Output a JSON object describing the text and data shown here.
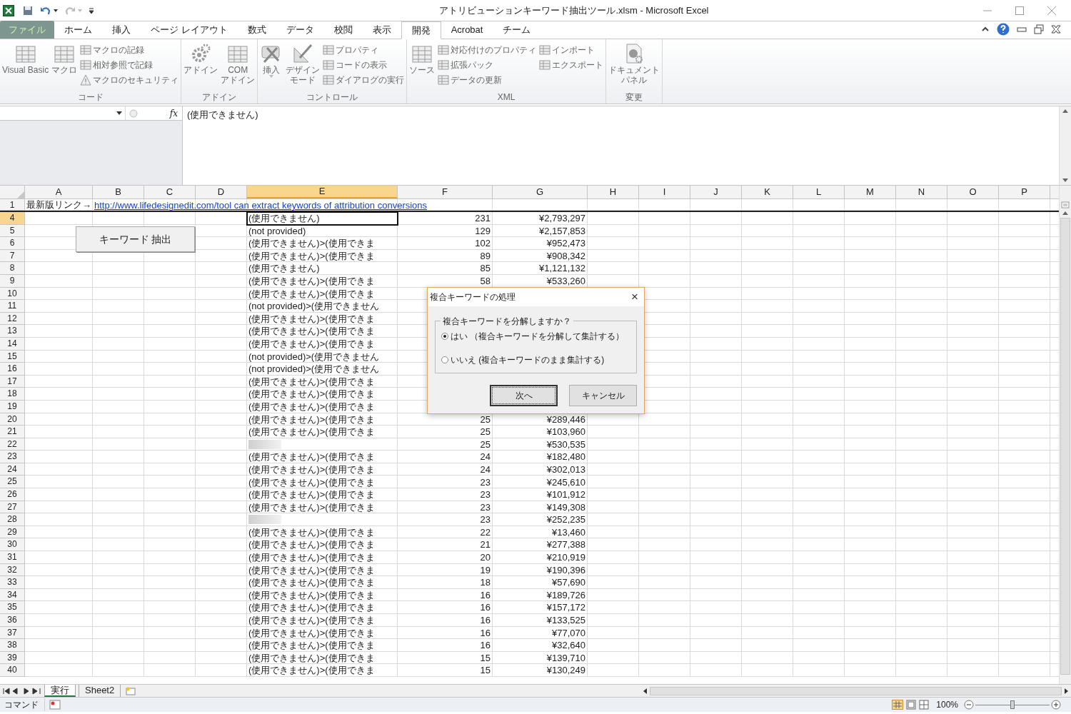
{
  "window": {
    "title": "アトリビューションキーワード抽出ツール.xlsm - Microsoft Excel"
  },
  "ribbon_tabs": [
    {
      "label": "ファイル",
      "kind": "file",
      "selected": false
    },
    {
      "label": "ホーム",
      "kind": "tab",
      "selected": false
    },
    {
      "label": "挿入",
      "kind": "tab",
      "selected": false
    },
    {
      "label": "ページ レイアウト",
      "kind": "tab",
      "selected": false
    },
    {
      "label": "数式",
      "kind": "tab",
      "selected": false
    },
    {
      "label": "データ",
      "kind": "tab",
      "selected": false
    },
    {
      "label": "校閲",
      "kind": "tab",
      "selected": false
    },
    {
      "label": "表示",
      "kind": "tab",
      "selected": false
    },
    {
      "label": "開発",
      "kind": "tab",
      "selected": true
    },
    {
      "label": "Acrobat",
      "kind": "tab",
      "selected": false
    },
    {
      "label": "チーム",
      "kind": "tab",
      "selected": false
    }
  ],
  "ribbon_groups": [
    {
      "label": "コード",
      "large": [
        [
          "Visual Basic"
        ],
        [
          "マクロ"
        ]
      ],
      "small": [
        [
          "マクロの記録",
          "相対参照で記録",
          "マクロのセキュリティ"
        ]
      ]
    },
    {
      "label": "アドイン",
      "large": [
        [
          "アドイン"
        ],
        [
          "COM",
          "アドイン"
        ]
      ]
    },
    {
      "label": "コントロール",
      "large": [
        [
          "挿入"
        ],
        [
          "デザイン",
          "モード"
        ]
      ],
      "small": [
        [
          "プロパティ",
          "コードの表示",
          "ダイアログの実行"
        ]
      ]
    },
    {
      "label": "XML",
      "large": [
        [
          "ソース"
        ]
      ],
      "small": [
        [
          "対応付けのプロパティ",
          "拡張パック",
          "データの更新"
        ],
        [
          "インポート",
          "エクスポート"
        ]
      ]
    },
    {
      "label": "変更",
      "large": [
        [
          "ドキュメント",
          "パネル"
        ]
      ]
    }
  ],
  "formula_bar": {
    "fx": "fx",
    "value": "(使用できません)"
  },
  "columns": [
    {
      "label": "A",
      "selected": false
    },
    {
      "label": "B",
      "selected": false
    },
    {
      "label": "C",
      "selected": false
    },
    {
      "label": "D",
      "selected": false
    },
    {
      "label": "E",
      "selected": true
    },
    {
      "label": "F",
      "selected": false
    },
    {
      "label": "G",
      "selected": false
    },
    {
      "label": "H",
      "selected": false
    },
    {
      "label": "I",
      "selected": false
    },
    {
      "label": "J",
      "selected": false
    },
    {
      "label": "K",
      "selected": false
    },
    {
      "label": "L",
      "selected": false
    },
    {
      "label": "M",
      "selected": false
    },
    {
      "label": "N",
      "selected": false
    },
    {
      "label": "O",
      "selected": false
    },
    {
      "label": "P",
      "selected": false
    }
  ],
  "rows": [
    {
      "number": "1",
      "selected": false,
      "a": "最新版リンク→",
      "link": "http://www.lifedesignedit.com/tool can extract keywords of attribution conversions"
    },
    {
      "number": "4",
      "selected": true,
      "e": "(使用できません)",
      "f": "231",
      "g": "¥2,793,297"
    },
    {
      "number": "5",
      "selected": false,
      "e": "(not provided)",
      "f": "129",
      "g": "¥2,157,853"
    },
    {
      "number": "6",
      "selected": false,
      "e": "(使用できません)>(使用できま",
      "f": "102",
      "g": "¥952,473"
    },
    {
      "number": "7",
      "selected": false,
      "e": "(使用できません)>(使用できま",
      "f": "89",
      "g": "¥908,342"
    },
    {
      "number": "8",
      "selected": false,
      "e": "(使用できません)",
      "f": "85",
      "g": "¥1,121,132"
    },
    {
      "number": "9",
      "selected": false,
      "e": "(使用できません)>(使用できま",
      "f": "58",
      "g": "¥533,260"
    },
    {
      "number": "10",
      "selected": false,
      "e": "(使用できません)>(使用できま"
    },
    {
      "number": "11",
      "selected": false,
      "e": "(not provided)>(使用できません"
    },
    {
      "number": "12",
      "selected": false,
      "e": "(使用できません)>(使用できま"
    },
    {
      "number": "13",
      "selected": false,
      "e": "(使用できません)>(使用できま"
    },
    {
      "number": "14",
      "selected": false,
      "e": "(使用できません)>(使用できま"
    },
    {
      "number": "15",
      "selected": false,
      "e": "(not provided)>(使用できません"
    },
    {
      "number": "16",
      "selected": false,
      "e": "(not provided)>(使用できません"
    },
    {
      "number": "17",
      "selected": false,
      "e": "(使用できません)>(使用できま"
    },
    {
      "number": "18",
      "selected": false,
      "e": "(使用できません)>(使用できま"
    },
    {
      "number": "19",
      "selected": false,
      "e": "(使用できません)>(使用できま"
    },
    {
      "number": "20",
      "selected": false,
      "e": "(使用できません)>(使用できま",
      "f": "25",
      "g": "¥289,446"
    },
    {
      "number": "21",
      "selected": false,
      "e": "(使用できません)>(使用できま",
      "f": "25",
      "g": "¥103,960"
    },
    {
      "number": "22",
      "selected": false,
      "redacted": true,
      "f": "25",
      "g": "¥530,535"
    },
    {
      "number": "23",
      "selected": false,
      "e": "(使用できません)>(使用できま",
      "f": "24",
      "g": "¥182,480"
    },
    {
      "number": "24",
      "selected": false,
      "e": "(使用できません)>(使用できま",
      "f": "24",
      "g": "¥302,013"
    },
    {
      "number": "25",
      "selected": false,
      "e": "(使用できません)>(使用できま",
      "f": "23",
      "g": "¥245,610"
    },
    {
      "number": "26",
      "selected": false,
      "e": "(使用できません)>(使用できま",
      "f": "23",
      "g": "¥101,912"
    },
    {
      "number": "27",
      "selected": false,
      "e": "(使用できません)>(使用できま",
      "f": "23",
      "g": "¥149,308"
    },
    {
      "number": "28",
      "selected": false,
      "redacted": true,
      "f": "23",
      "g": "¥252,235"
    },
    {
      "number": "29",
      "selected": false,
      "e": "(使用できません)>(使用できま",
      "f": "22",
      "g": "¥13,460"
    },
    {
      "number": "30",
      "selected": false,
      "e": "(使用できません)>(使用できま",
      "f": "21",
      "g": "¥277,388"
    },
    {
      "number": "31",
      "selected": false,
      "e": "(使用できません)>(使用できま",
      "f": "20",
      "g": "¥210,919"
    },
    {
      "number": "32",
      "selected": false,
      "e": "(使用できません)>(使用できま",
      "f": "19",
      "g": "¥190,396"
    },
    {
      "number": "33",
      "selected": false,
      "e": "(使用できません)>(使用できま",
      "f": "18",
      "g": "¥57,690"
    },
    {
      "number": "34",
      "selected": false,
      "e": "(使用できません)>(使用できま",
      "f": "16",
      "g": "¥189,726"
    },
    {
      "number": "35",
      "selected": false,
      "e": "(使用できません)>(使用できま",
      "f": "16",
      "g": "¥157,172"
    },
    {
      "number": "36",
      "selected": false,
      "e": "(使用できません)>(使用できま",
      "f": "16",
      "g": "¥133,525"
    },
    {
      "number": "37",
      "selected": false,
      "e": "(使用できません)>(使用できま",
      "f": "16",
      "g": "¥77,070"
    },
    {
      "number": "38",
      "selected": false,
      "e": "(使用できません)>(使用できま",
      "f": "16",
      "g": "¥32,640"
    },
    {
      "number": "39",
      "selected": false,
      "e": "(使用できません)>(使用できま",
      "f": "15",
      "g": "¥139,710"
    },
    {
      "number": "40",
      "selected": false,
      "e": "(使用できません)>(使用できま",
      "f": "15",
      "g": "¥130,249"
    }
  ],
  "sheet_button": {
    "label": "キーワード 抽出"
  },
  "dialog": {
    "title": "複合キーワードの処理",
    "close": "×",
    "group_label": "複合キーワードを分解しますか？",
    "options": [
      {
        "label": "はい （複合キーワードを分解して集計する）",
        "selected": true
      },
      {
        "label": "いいえ (複合キーワードのまま集計する)",
        "selected": false
      }
    ],
    "buttons": [
      {
        "label": "次へ",
        "default": true
      },
      {
        "label": "キャンセル",
        "default": false
      }
    ]
  },
  "sheet_tabs": [
    {
      "label": "実行",
      "selected": true
    },
    {
      "label": "Sheet2",
      "selected": false
    }
  ],
  "status_bar": {
    "mode": "コマンド",
    "zoom": "100%",
    "zoom_level": {
      "level": 0.5
    }
  }
}
